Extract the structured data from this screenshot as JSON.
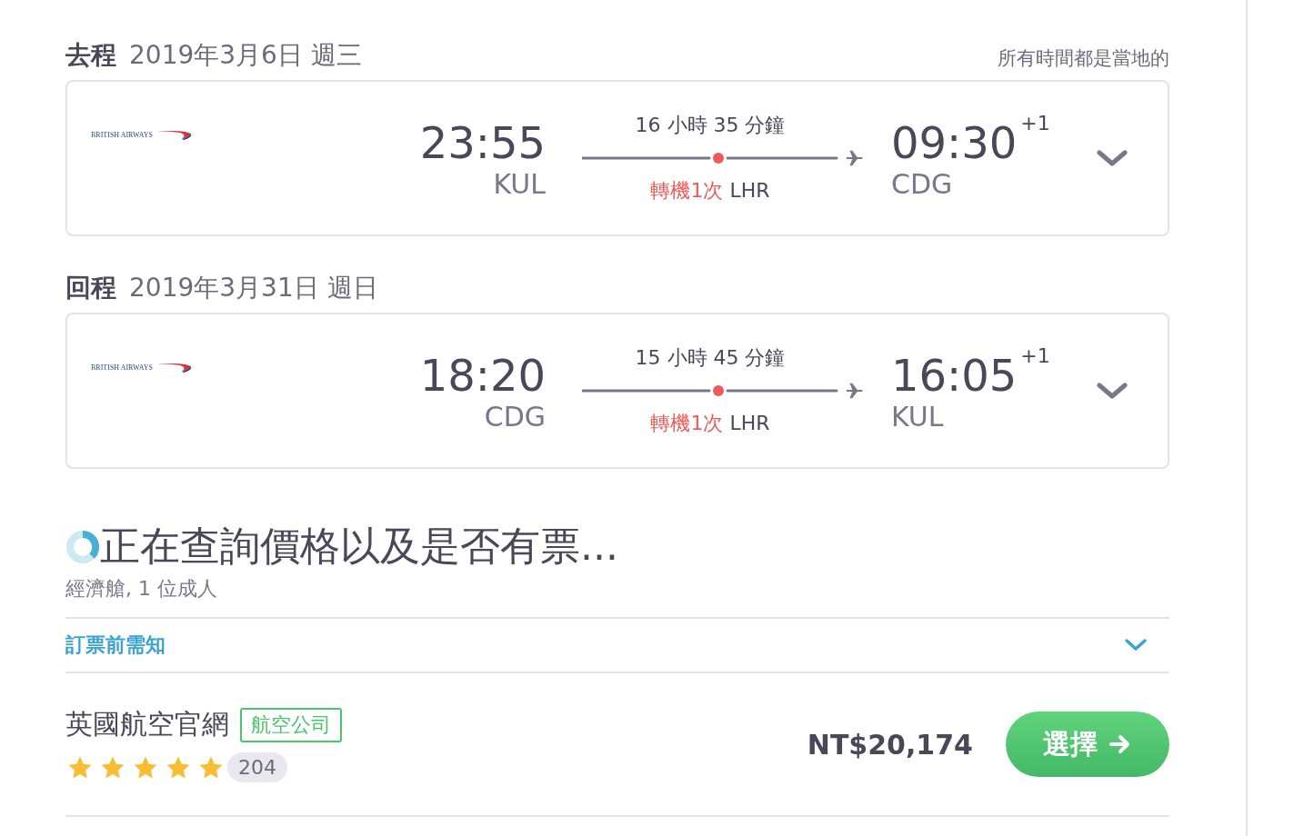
{
  "legs": [
    {
      "label": "去程",
      "date": "2019年3月6日 週三",
      "note": "所有時間都是當地的",
      "airline_logo": "BRITISH AIRWAYS",
      "depart_time": "23:55",
      "depart_code": "KUL",
      "duration": "16 小時 35 分鐘",
      "stops": "轉機1次",
      "via": "LHR",
      "arrive_time": "09:30",
      "arrive_offset": "+1",
      "arrive_code": "CDG",
      "expanded": false
    },
    {
      "label": "回程",
      "date": "2019年3月31日 週日",
      "airline_logo": "BRITISH AIRWAYS",
      "depart_time": "18:20",
      "depart_code": "CDG",
      "duration": "15 小時 45 分鐘",
      "stops": "轉機1次",
      "via": "LHR",
      "arrive_time": "16:05",
      "arrive_offset": "+1",
      "arrive_code": "KUL",
      "expanded": false
    }
  ],
  "status": {
    "title": "正在查詢價格以及是否有票...",
    "subtitle": "經濟艙, 1 位成人"
  },
  "notice": {
    "label": "訂票前需知",
    "expanded": false
  },
  "offer": {
    "name": "英國航空官網",
    "tag": "航空公司",
    "stars": 5,
    "reviews": "204",
    "price": "NT$20,174",
    "button": "選擇"
  }
}
